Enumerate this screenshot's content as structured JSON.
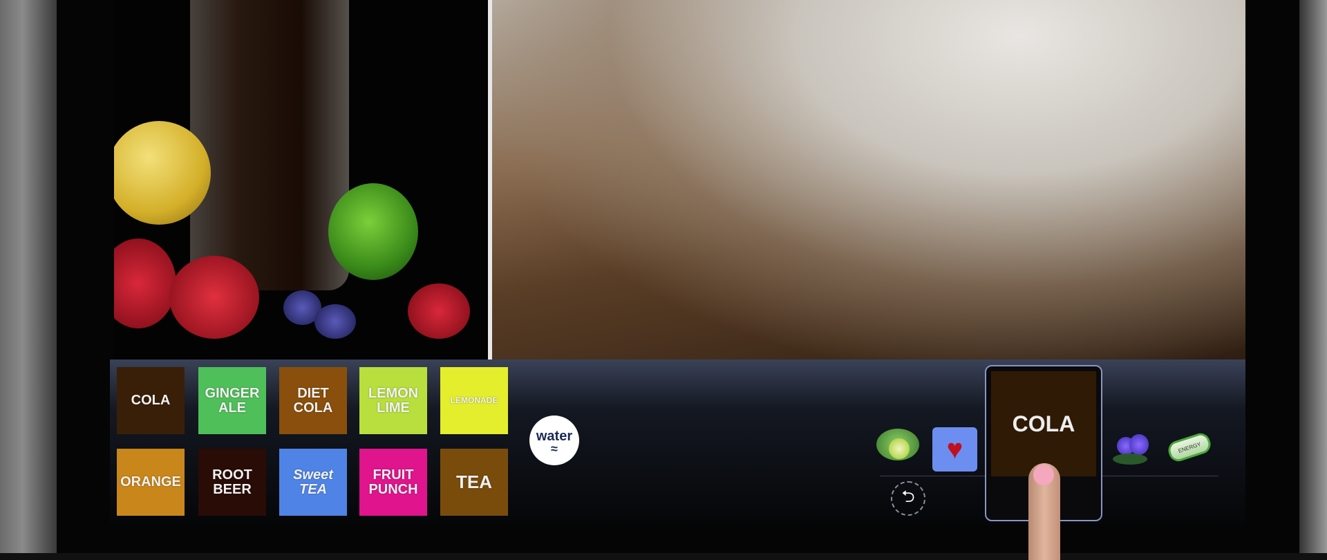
{
  "drinks": {
    "row1": [
      {
        "label": "COLA",
        "color": "#3a1f08"
      },
      {
        "label": "GINGER ALE",
        "color": "#4fbf5a"
      },
      {
        "label": "DIET COLA",
        "color": "#8a4f0c"
      },
      {
        "label": "LEMON LIME",
        "color": "#b8df3e"
      },
      {
        "label": "LEMONADE",
        "color": "#e4ee2c"
      }
    ],
    "row2": [
      {
        "label": "ORANGE",
        "color": "#c9861a"
      },
      {
        "label": "ROOT BEER",
        "color": "#2a0c06"
      },
      {
        "label": "Sweet TEA",
        "color": "#4f84e6"
      },
      {
        "label": "FRUIT PUNCH",
        "color": "#e0148c"
      },
      {
        "label": "TEA",
        "color": "#7a4c0c"
      }
    ]
  },
  "water": {
    "label": "water"
  },
  "selection": {
    "selected_label": "COLA",
    "flavors": [
      {
        "icon": "lime-icon"
      },
      {
        "icon": "strawberry-heart-icon",
        "selected": true,
        "color": "#6c8ef0"
      },
      {
        "icon": "raspberry-icon"
      },
      {
        "icon": "energy-battery-icon",
        "text": "ENERGY"
      }
    ],
    "undo_icon": "undo-icon"
  }
}
